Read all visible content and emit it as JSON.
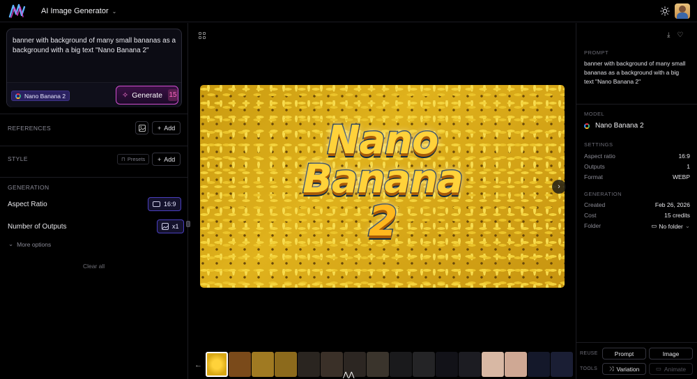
{
  "header": {
    "title": "AI Image Generator"
  },
  "prompt_box": {
    "text": "banner with background of many small bananas as a background with a big text \"Nano Banana 2\"",
    "model": "Nano Banana 2",
    "generate_label": "Generate",
    "generate_cost": "15"
  },
  "references": {
    "title": "REFERENCES",
    "add_label": "Add"
  },
  "style": {
    "title": "STYLE",
    "presets_label": "Presets",
    "add_label": "Add"
  },
  "generation": {
    "title": "GENERATION",
    "aspect_ratio_label": "Aspect Ratio",
    "aspect_ratio_value": "16:9",
    "outputs_label": "Number of Outputs",
    "outputs_value": "x1",
    "more_options": "More options",
    "clear_all": "Clear all"
  },
  "image": {
    "line1": "Nano",
    "line2": "Banana",
    "line3": "2"
  },
  "details": {
    "prompt_label": "PROMPT",
    "prompt": "banner with background of many small bananas as a background with a big text \"Nano Banana 2\"",
    "model_label": "MODEL",
    "model": "Nano Banana 2",
    "settings_label": "SETTINGS",
    "settings": [
      {
        "k": "Aspect ratio",
        "v": "16:9"
      },
      {
        "k": "Outputs",
        "v": "1"
      },
      {
        "k": "Format",
        "v": "WEBP"
      }
    ],
    "generation_label": "GENERATION",
    "generation": [
      {
        "k": "Created",
        "v": "Feb 26, 2026"
      },
      {
        "k": "Cost",
        "v": "15 credits"
      },
      {
        "k": "Folder",
        "v": "No folder"
      }
    ],
    "reuse_label": "REUSE",
    "tools_label": "TOOLS",
    "prompt_btn": "Prompt",
    "image_btn": "Image",
    "variation_btn": "Variation",
    "animate_btn": "Animate"
  },
  "thumbnails": [
    {
      "color": "#d9a815",
      "label": "Nano Banana 2"
    },
    {
      "color": "#7a4a1a"
    },
    {
      "color": "#a07a22"
    },
    {
      "color": "#8c6a1c"
    },
    {
      "color": "#2a2520"
    },
    {
      "color": "#3a3028"
    },
    {
      "color": "#2c2622"
    },
    {
      "color": "#3a342c"
    },
    {
      "color": "#1a1a1c"
    },
    {
      "color": "#242426"
    },
    {
      "color": "#121218"
    },
    {
      "color": "#1c1c22"
    },
    {
      "color": "#d8b8a4"
    },
    {
      "color": "#cfa894"
    },
    {
      "color": "#14182a"
    },
    {
      "color": "#1a1e34"
    }
  ],
  "colors": {
    "accent_purple": "#4a3fc0",
    "generate_border": "#d24fd0",
    "generate_count": "#ff6ac2"
  }
}
